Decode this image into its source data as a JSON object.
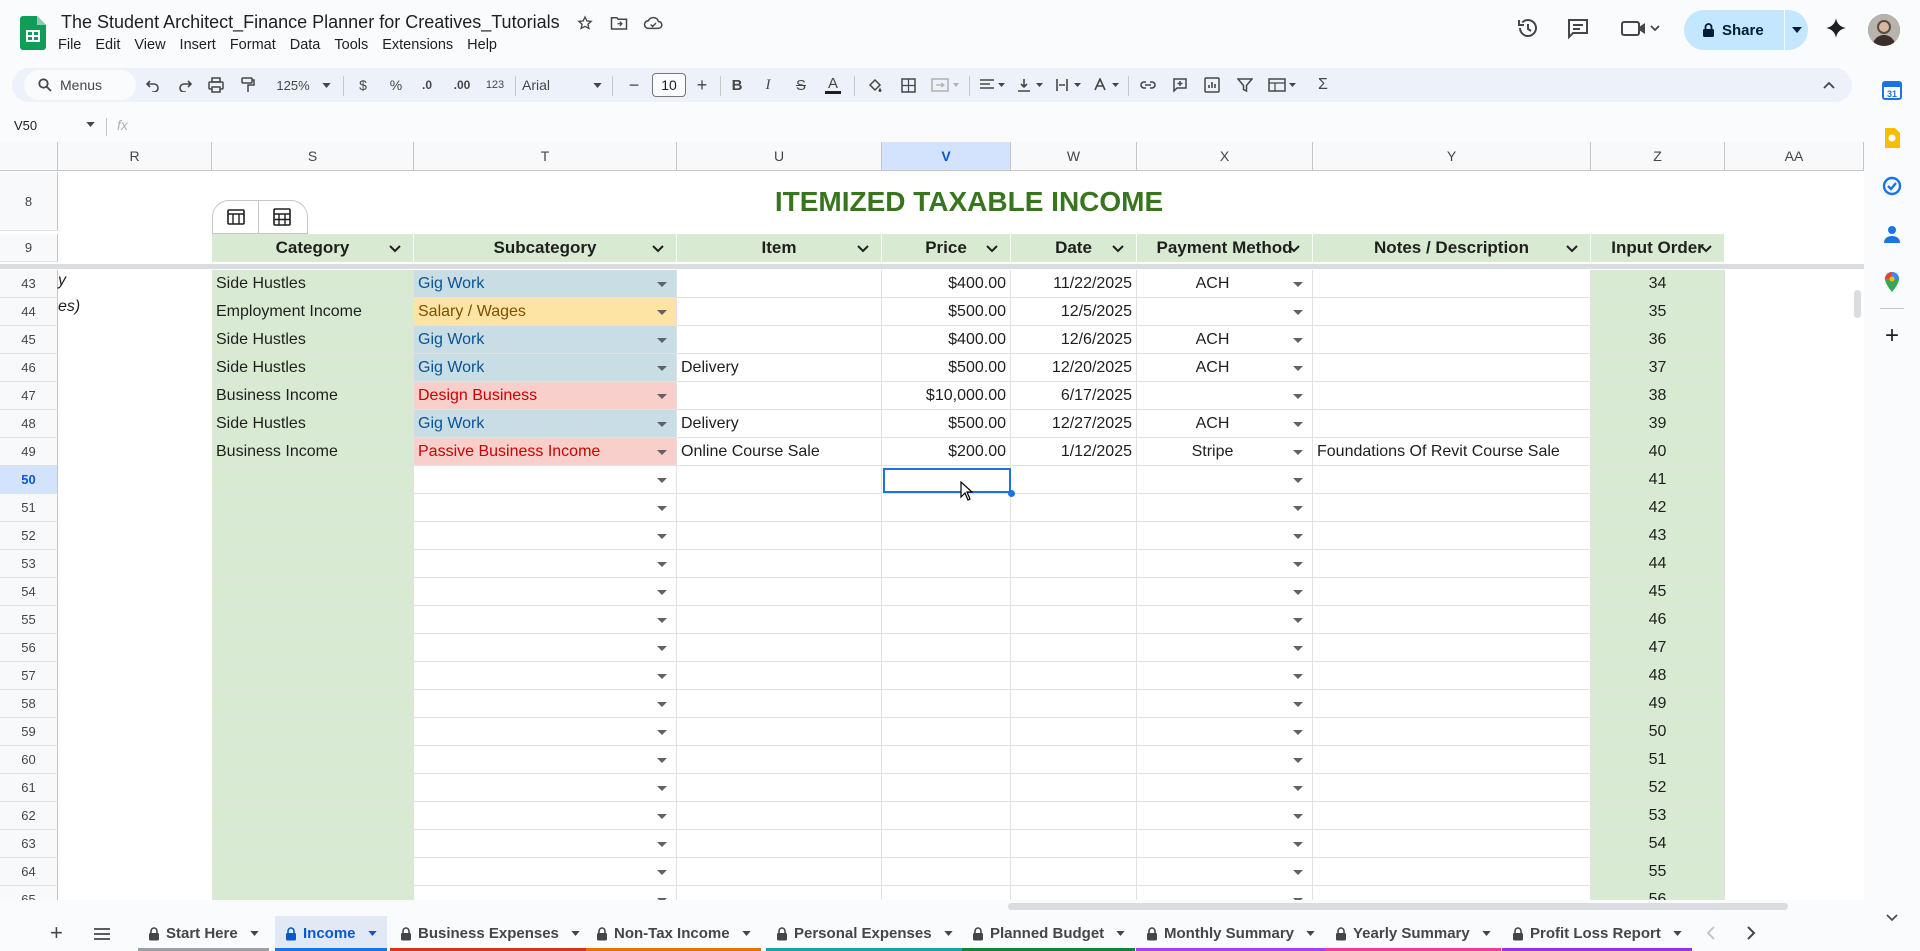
{
  "doc": {
    "title": "The Student Architect_Finance Planner for Creatives_Tutorials"
  },
  "menu": [
    "File",
    "Edit",
    "View",
    "Insert",
    "Format",
    "Data",
    "Tools",
    "Extensions",
    "Help"
  ],
  "share": {
    "label": "Share"
  },
  "toolbar": {
    "search_label": "Menus",
    "zoom": "125%",
    "currency": "$",
    "percent": "%",
    "dec_less": ".0",
    "dec_more": ".00",
    "number_format": "123",
    "font": "Arial",
    "font_size": "10"
  },
  "formula": {
    "cell_ref": "V50",
    "fx": "fx"
  },
  "grid": {
    "columns": [
      "R",
      "S",
      "T",
      "U",
      "V",
      "W",
      "X",
      "Y",
      "Z",
      "AA"
    ],
    "selected_column": "V",
    "title": "ITEMIZED TAXABLE INCOME",
    "headers": [
      "Category",
      "Subcategory",
      "Item",
      "Price",
      "Date",
      "Payment Method",
      "Notes / Description",
      "Input Order"
    ],
    "left_fragments": [
      "y",
      "es)"
    ],
    "row_numbers": [
      "8",
      "9",
      "43",
      "44",
      "45",
      "46",
      "47",
      "48",
      "49",
      "50",
      "51",
      "52",
      "53",
      "54",
      "55",
      "56",
      "57",
      "58",
      "59",
      "60",
      "61",
      "62",
      "63",
      "64",
      "65"
    ],
    "selected_row": "50",
    "rows": [
      {
        "category": "Side Hustles",
        "subcategory": "Gig Work",
        "sub_color": "#c9dde4",
        "item": "",
        "price": "$400.00",
        "date": "11/22/2025",
        "method": "ACH",
        "notes": "",
        "order": "34"
      },
      {
        "category": "Employment Income",
        "subcategory": "Salary / Wages",
        "sub_color": "#fde4a5",
        "item": "",
        "price": "$500.00",
        "date": "12/5/2025",
        "method": "",
        "notes": "",
        "order": "35"
      },
      {
        "category": "Side Hustles",
        "subcategory": "Gig Work",
        "sub_color": "#c9dde4",
        "item": "",
        "price": "$400.00",
        "date": "12/6/2025",
        "method": "ACH",
        "notes": "",
        "order": "36"
      },
      {
        "category": "Side Hustles",
        "subcategory": "Gig Work",
        "sub_color": "#c9dde4",
        "item": "Delivery",
        "price": "$500.00",
        "date": "12/20/2025",
        "method": "ACH",
        "notes": "",
        "order": "37"
      },
      {
        "category": "Business Income",
        "subcategory": "Design Business",
        "sub_color": "#f8cfcb",
        "item": "",
        "price": "$10,000.00",
        "date": "6/17/2025",
        "method": "",
        "notes": "",
        "order": "38"
      },
      {
        "category": "Side Hustles",
        "subcategory": "Gig Work",
        "sub_color": "#c9dde4",
        "item": "Delivery",
        "price": "$500.00",
        "date": "12/27/2025",
        "method": "ACH",
        "notes": "",
        "order": "39"
      },
      {
        "category": "Business Income",
        "subcategory": "Passive Business Income",
        "sub_color": "#f8cfcb",
        "item": "Online Course Sale",
        "price": "$200.00",
        "date": "1/12/2025",
        "method": "Stripe",
        "notes": "Foundations Of Revit Course Sale",
        "order": "40"
      }
    ],
    "empty_orders": [
      "41",
      "42",
      "43",
      "44",
      "45",
      "46",
      "47",
      "48",
      "49",
      "50",
      "51",
      "52",
      "53",
      "54",
      "55",
      "56"
    ]
  },
  "sheets": [
    {
      "label": "Start Here",
      "color": "#9aa0a6",
      "active": false
    },
    {
      "label": "Income",
      "color": "#1a73e8",
      "active": true
    },
    {
      "label": "Business Expenses",
      "color": "#d93025",
      "active": false
    },
    {
      "label": "Non-Tax Income",
      "color": "#e37400",
      "active": false
    },
    {
      "label": "Personal Expenses",
      "color": "#12a4af",
      "active": false
    },
    {
      "label": "Planned Budget",
      "color": "#188038",
      "active": false
    },
    {
      "label": "Monthly Summary",
      "color": "#a142f4",
      "active": false
    },
    {
      "label": "Yearly Summary",
      "color": "#f538a0",
      "active": false
    },
    {
      "label": "Profit Loss Report",
      "color": "#9334e6",
      "active": false
    }
  ],
  "colors": {
    "accent": "#1a73e8",
    "header_green": "#d9ead3",
    "title_green": "#38761d"
  }
}
